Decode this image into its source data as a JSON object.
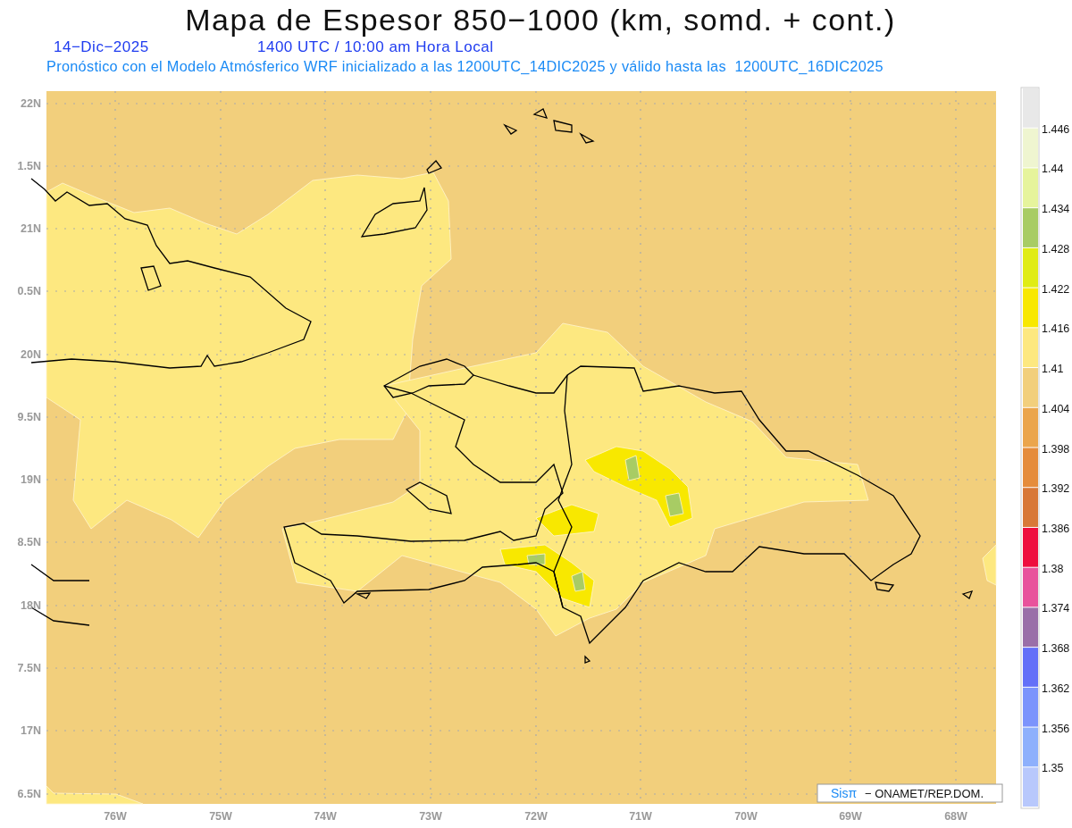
{
  "header": {
    "title": "Mapa de Espesor 850−1000 (km, somd. + cont.)",
    "date": "14−Dic−2025",
    "time": "1400 UTC / 10:00 am Hora Local",
    "subtitle": "Pronóstico con el Modelo Atmósferico WRF inicializado a las 1200UTC_14DIC2025 y válido hasta las  1200UTC_16DIC2025"
  },
  "map": {
    "lat_labels": [
      "22N",
      "1.5N",
      "21N",
      "0.5N",
      "20N",
      "9.5N",
      "19N",
      "8.5N",
      "18N",
      "7.5N",
      "17N",
      "6.5N"
    ],
    "lon_labels": [
      "76W",
      "75W",
      "74W",
      "73W",
      "72W",
      "71W",
      "70W",
      "69W",
      "68W"
    ],
    "credit": {
      "brand": "Sisπ",
      "text": "− ONAMET/REP.DOM."
    }
  },
  "legend": {
    "bins": [
      {
        "color": "#e8e8e8"
      },
      {
        "color": "#eff5d0"
      },
      {
        "color": "#e6f49c"
      },
      {
        "color": "#a8cc64"
      },
      {
        "color": "#e0ec14"
      },
      {
        "color": "#f8e800"
      },
      {
        "color": "#fde880"
      },
      {
        "color": "#f2cf7c"
      },
      {
        "color": "#eba54c"
      },
      {
        "color": "#e58c3c"
      },
      {
        "color": "#d87838"
      },
      {
        "color": "#ee0e3e"
      },
      {
        "color": "#e8529c"
      },
      {
        "color": "#9a6fa8"
      },
      {
        "color": "#6470f8"
      },
      {
        "color": "#7c94fc"
      },
      {
        "color": "#8eb0fc"
      },
      {
        "color": "#b8c8fc"
      }
    ],
    "labels": [
      "1.446",
      "1.44",
      "1.434",
      "1.428",
      "1.422",
      "1.416",
      "1.41",
      "1.404",
      "1.398",
      "1.392",
      "1.386",
      "1.38",
      "1.374",
      "1.368",
      "1.362",
      "1.356",
      "1.35"
    ]
  }
}
